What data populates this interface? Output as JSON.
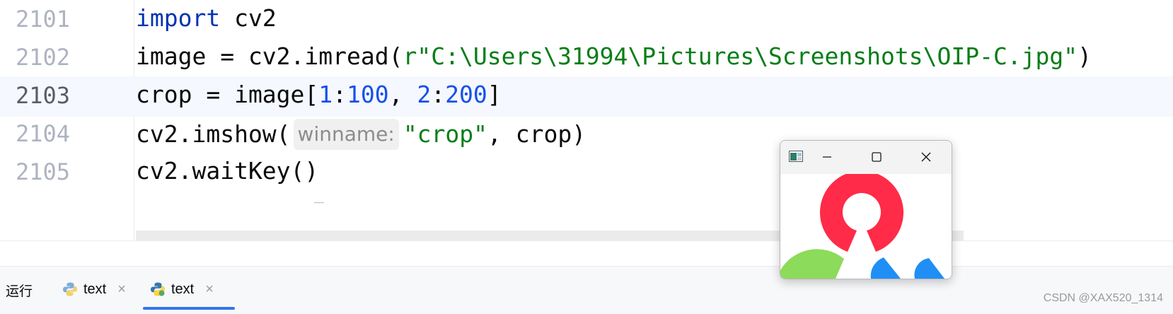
{
  "editor": {
    "lines": [
      {
        "number": "2101",
        "tokens": [
          {
            "t": "import",
            "c": "kw"
          },
          {
            "t": " cv2",
            "c": ""
          }
        ]
      },
      {
        "number": "2102",
        "tokens": [
          {
            "t": "image = cv2.imread(",
            "c": ""
          },
          {
            "t": "r\"C:\\Users\\31994\\Pictures\\Screenshots\\OIP-C.jpg\"",
            "c": "str"
          },
          {
            "t": ")",
            "c": ""
          }
        ]
      },
      {
        "number": "2103",
        "tokens": [
          {
            "t": "crop = image[",
            "c": ""
          },
          {
            "t": "1",
            "c": "num"
          },
          {
            "t": ":",
            "c": ""
          },
          {
            "t": "100",
            "c": "num"
          },
          {
            "t": ", ",
            "c": ""
          },
          {
            "t": "2",
            "c": "num"
          },
          {
            "t": ":",
            "c": ""
          },
          {
            "t": "200",
            "c": "num"
          },
          {
            "t": "]",
            "c": ""
          }
        ]
      },
      {
        "number": "2104",
        "tokens": [
          {
            "t": "cv2.imshow(",
            "c": ""
          },
          {
            "t": "winname:",
            "c": "hint"
          },
          {
            "t": "\"crop\"",
            "c": "str"
          },
          {
            "t": ", crop)",
            "c": ""
          }
        ]
      },
      {
        "number": "2105",
        "tokens": [
          {
            "t": "cv2.waitKey()",
            "c": ""
          }
        ]
      }
    ],
    "current_line": "2103"
  },
  "bottom_panel": {
    "run_label": "运行",
    "tabs": [
      {
        "label": "text",
        "close": "×",
        "icon": "python-icon",
        "active": false
      },
      {
        "label": "text",
        "close": "×",
        "icon": "python-icon",
        "active": true
      }
    ]
  },
  "cv_window": {
    "title": "",
    "minimize_icon": "minimize-icon",
    "maximize_icon": "maximize-icon",
    "close_icon": "close-icon"
  },
  "watermark": "CSDN @XAX520_1314",
  "colors": {
    "keyword": "#0033b3",
    "string": "#067d17",
    "number": "#1750eb",
    "current_line_bg": "#f5f8fe",
    "tab_underline": "#3574f0",
    "logo_red": "#ff2b48",
    "logo_green": "#8cdb5a",
    "logo_blue": "#1f8ff5"
  }
}
